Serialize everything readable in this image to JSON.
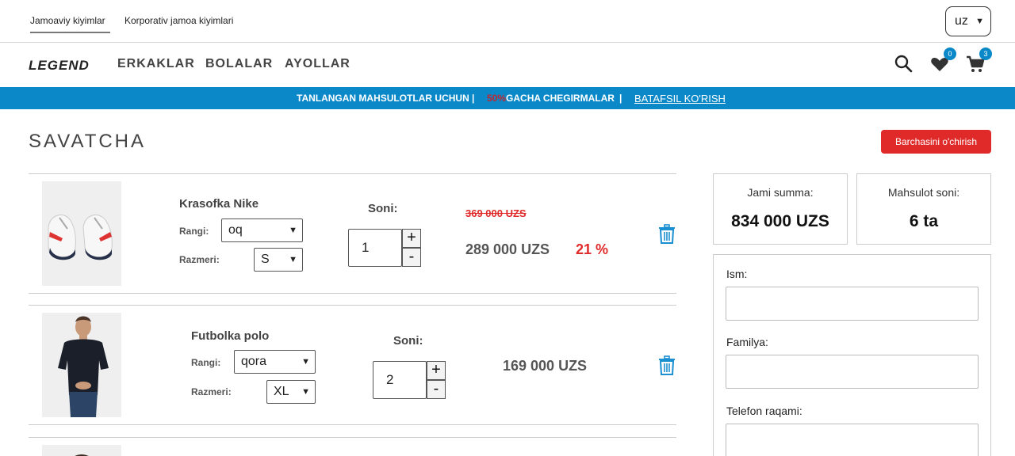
{
  "topbar": {
    "tab_active": "Jamoaviy kiyimlar",
    "tab_second": "Korporativ jamoa kiyimlari",
    "language": "uz"
  },
  "nav": {
    "logo": "LEGEND",
    "links": [
      "ERKAKLAR",
      "BOLALAR",
      "AYOLLAR"
    ],
    "wishlist_count": "0",
    "cart_count": "3",
    "icons": [
      "search-icon",
      "heart-icon",
      "cart-icon"
    ]
  },
  "promo": {
    "text1": "TANLANGAN MAHSULOTLAR UCHUN",
    "separator": "|",
    "percent": "50%",
    "text2": "GACHA CHEGIRMALAR",
    "link": "BATAFSIL KO'RISH"
  },
  "cart": {
    "title": "SAVATCHA",
    "clear_label": "Barchasini o'chirish",
    "color_label": "Rangi:",
    "size_label": "Razmeri:",
    "qty_label": "Soni:",
    "items": [
      {
        "name": "Krasofka Nike",
        "color": "oq",
        "size": "S",
        "qty": "1",
        "old_price": "369 000 UZS",
        "price": "289 000 UZS",
        "discount": "21 %"
      },
      {
        "name": "Futbolka polo",
        "color": "qora",
        "size": "XL",
        "qty": "2",
        "price": "169 000 UZS"
      }
    ]
  },
  "summary": {
    "total_label": "Jami summa:",
    "total_value": "834 000 UZS",
    "count_label": "Mahsulot soni:",
    "count_value": "6 ta"
  },
  "form": {
    "name_label": "Ism:",
    "surname_label": "Familya:",
    "phone_label": "Telefon raqami:"
  },
  "colors": {
    "accent": "#0a88c8",
    "danger": "#e02a2a"
  }
}
